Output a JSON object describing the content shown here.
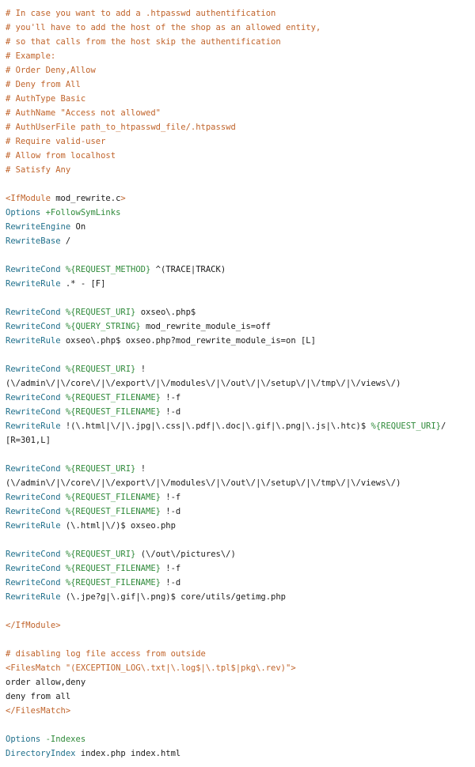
{
  "colors": {
    "comment": "#c0632a",
    "directive": "#1f6f8b",
    "variable": "#2f8a3a",
    "text": "#1a1a1a",
    "background": "#ffffff"
  },
  "lines": [
    [
      {
        "t": "# In case you want to add a .htpasswd authentification",
        "c": "comment"
      }
    ],
    [
      {
        "t": "# you'll have to add the host of the shop as an allowed entity,",
        "c": "comment"
      }
    ],
    [
      {
        "t": "# so that calls from the host skip the authentification",
        "c": "comment"
      }
    ],
    [
      {
        "t": "# Example:",
        "c": "comment"
      }
    ],
    [
      {
        "t": "# Order Deny,Allow",
        "c": "comment"
      }
    ],
    [
      {
        "t": "# Deny from All",
        "c": "comment"
      }
    ],
    [
      {
        "t": "# AuthType Basic",
        "c": "comment"
      }
    ],
    [
      {
        "t": "# AuthName \"Access not allowed\"",
        "c": "comment"
      }
    ],
    [
      {
        "t": "# AuthUserFile path_to_htpasswd_file/.htpasswd",
        "c": "comment"
      }
    ],
    [
      {
        "t": "# Require valid-user",
        "c": "comment"
      }
    ],
    [
      {
        "t": "# Allow from localhost",
        "c": "comment"
      }
    ],
    [
      {
        "t": "# Satisfy Any",
        "c": "comment"
      }
    ],
    [],
    [
      {
        "t": "<IfModule ",
        "c": "tag"
      },
      {
        "t": "mod_rewrite.c",
        "c": "plain"
      },
      {
        "t": ">",
        "c": "tag"
      }
    ],
    [
      {
        "t": "Options ",
        "c": "directive"
      },
      {
        "t": "+FollowSymLinks",
        "c": "variable"
      }
    ],
    [
      {
        "t": "RewriteEngine ",
        "c": "directive"
      },
      {
        "t": "On",
        "c": "plain"
      }
    ],
    [
      {
        "t": "RewriteBase ",
        "c": "directive"
      },
      {
        "t": "/",
        "c": "plain"
      }
    ],
    [],
    [
      {
        "t": "RewriteCond ",
        "c": "directive"
      },
      {
        "t": "%{REQUEST_METHOD}",
        "c": "variable"
      },
      {
        "t": " ^(TRACE|TRACK)",
        "c": "plain"
      }
    ],
    [
      {
        "t": "RewriteRule ",
        "c": "directive"
      },
      {
        "t": ".* - [F]",
        "c": "plain"
      }
    ],
    [],
    [
      {
        "t": "RewriteCond ",
        "c": "directive"
      },
      {
        "t": "%{REQUEST_URI}",
        "c": "variable"
      },
      {
        "t": " oxseo\\.php$",
        "c": "plain"
      }
    ],
    [
      {
        "t": "RewriteCond ",
        "c": "directive"
      },
      {
        "t": "%{QUERY_STRING}",
        "c": "variable"
      },
      {
        "t": " mod_rewrite_module_is=off",
        "c": "plain"
      }
    ],
    [
      {
        "t": "RewriteRule ",
        "c": "directive"
      },
      {
        "t": "oxseo\\.php$ oxseo.php?mod_rewrite_module_is=on [L]",
        "c": "plain"
      }
    ],
    [],
    [
      {
        "t": "RewriteCond ",
        "c": "directive"
      },
      {
        "t": "%{REQUEST_URI}",
        "c": "variable"
      },
      {
        "t": " !",
        "c": "plain"
      }
    ],
    [
      {
        "t": "(\\/admin\\/|\\/core\\/|\\/export\\/|\\/modules\\/|\\/out\\/|\\/setup\\/|\\/tmp\\/|\\/views\\/)",
        "c": "plain"
      }
    ],
    [
      {
        "t": "RewriteCond ",
        "c": "directive"
      },
      {
        "t": "%{REQUEST_FILENAME}",
        "c": "variable"
      },
      {
        "t": " !-f",
        "c": "plain"
      }
    ],
    [
      {
        "t": "RewriteCond ",
        "c": "directive"
      },
      {
        "t": "%{REQUEST_FILENAME}",
        "c": "variable"
      },
      {
        "t": " !-d",
        "c": "plain"
      }
    ],
    [
      {
        "t": "RewriteRule ",
        "c": "directive"
      },
      {
        "t": "!(\\.html|\\/|\\.jpg|\\.css|\\.pdf|\\.doc|\\.gif|\\.png|\\.js|\\.htc)$ ",
        "c": "plain"
      },
      {
        "t": "%{REQUEST_URI}",
        "c": "variable"
      },
      {
        "t": "/",
        "c": "plain"
      }
    ],
    [
      {
        "t": "[R=301,L]",
        "c": "plain"
      }
    ],
    [],
    [
      {
        "t": "RewriteCond ",
        "c": "directive"
      },
      {
        "t": "%{REQUEST_URI}",
        "c": "variable"
      },
      {
        "t": " !",
        "c": "plain"
      }
    ],
    [
      {
        "t": "(\\/admin\\/|\\/core\\/|\\/export\\/|\\/modules\\/|\\/out\\/|\\/setup\\/|\\/tmp\\/|\\/views\\/)",
        "c": "plain"
      }
    ],
    [
      {
        "t": "RewriteCond ",
        "c": "directive"
      },
      {
        "t": "%{REQUEST_FILENAME}",
        "c": "variable"
      },
      {
        "t": " !-f",
        "c": "plain"
      }
    ],
    [
      {
        "t": "RewriteCond ",
        "c": "directive"
      },
      {
        "t": "%{REQUEST_FILENAME}",
        "c": "variable"
      },
      {
        "t": " !-d",
        "c": "plain"
      }
    ],
    [
      {
        "t": "RewriteRule ",
        "c": "directive"
      },
      {
        "t": "(\\.html|\\/)$ oxseo.php",
        "c": "plain"
      }
    ],
    [],
    [
      {
        "t": "RewriteCond ",
        "c": "directive"
      },
      {
        "t": "%{REQUEST_URI}",
        "c": "variable"
      },
      {
        "t": " (\\/out\\/pictures\\/)",
        "c": "plain"
      }
    ],
    [
      {
        "t": "RewriteCond ",
        "c": "directive"
      },
      {
        "t": "%{REQUEST_FILENAME}",
        "c": "variable"
      },
      {
        "t": " !-f",
        "c": "plain"
      }
    ],
    [
      {
        "t": "RewriteCond ",
        "c": "directive"
      },
      {
        "t": "%{REQUEST_FILENAME}",
        "c": "variable"
      },
      {
        "t": " !-d",
        "c": "plain"
      }
    ],
    [
      {
        "t": "RewriteRule ",
        "c": "directive"
      },
      {
        "t": "(\\.jpe?g|\\.gif|\\.png)$ core/utils/getimg.php",
        "c": "plain"
      }
    ],
    [],
    [
      {
        "t": "</IfModule>",
        "c": "tag"
      }
    ],
    [],
    [
      {
        "t": "# disabling log file access from outside",
        "c": "comment"
      }
    ],
    [
      {
        "t": "<FilesMatch ",
        "c": "tag"
      },
      {
        "t": "\"(EXCEPTION_LOG\\.txt|\\.log$|\\.tpl$|pkg\\.rev)\"",
        "c": "comment"
      },
      {
        "t": ">",
        "c": "tag"
      }
    ],
    [
      {
        "t": "order allow,deny",
        "c": "plain"
      }
    ],
    [
      {
        "t": "deny from all",
        "c": "plain"
      }
    ],
    [
      {
        "t": "</FilesMatch>",
        "c": "tag"
      }
    ],
    [],
    [
      {
        "t": "Options ",
        "c": "directive"
      },
      {
        "t": "-Indexes",
        "c": "variable"
      }
    ],
    [
      {
        "t": "DirectoryIndex ",
        "c": "directive"
      },
      {
        "t": "index.php index.html",
        "c": "plain"
      }
    ]
  ]
}
